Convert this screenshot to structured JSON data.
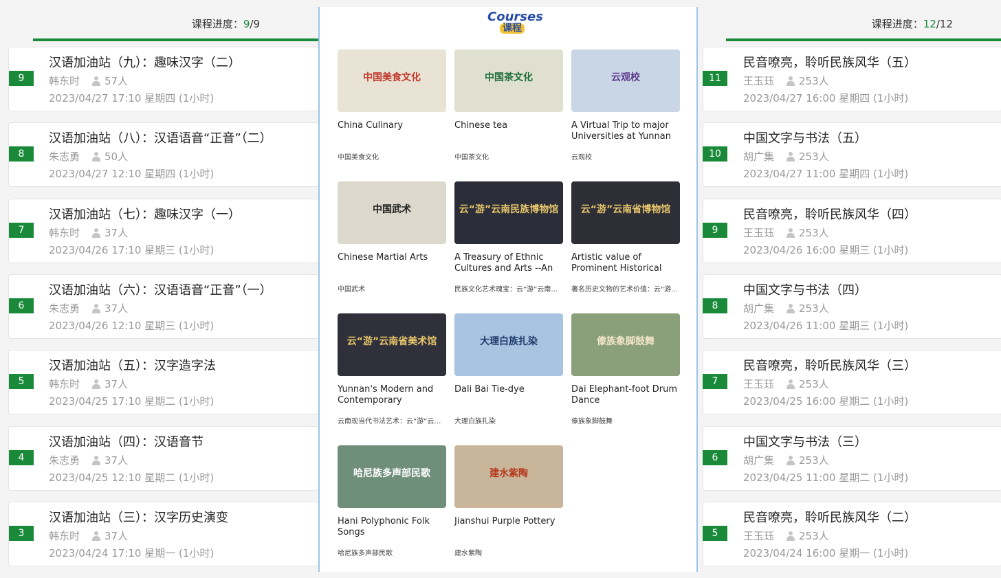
{
  "left_panel": {
    "progress_label": "课程进度：",
    "progress_done": "9",
    "progress_total": "/9",
    "items": [
      {
        "num": "9",
        "title": "汉语加油站（九）：趣味汉字（二）",
        "teacher": "韩东时",
        "count": "57人",
        "time": "2023/04/27 17:10 星期四 (1小时)"
      },
      {
        "num": "8",
        "title": "汉语加油站（八）：汉语语音“正音”（二）",
        "teacher": "朱志勇",
        "count": "50人",
        "time": "2023/04/27 12:10 星期四 (1小时)"
      },
      {
        "num": "7",
        "title": "汉语加油站（七）：趣味汉字（一）",
        "teacher": "韩东时",
        "count": "37人",
        "time": "2023/04/26 17:10 星期三 (1小时)"
      },
      {
        "num": "6",
        "title": "汉语加油站（六）：汉语语音“正音”（一）",
        "teacher": "朱志勇",
        "count": "37人",
        "time": "2023/04/26 12:10 星期三 (1小时)"
      },
      {
        "num": "5",
        "title": "汉语加油站（五）：汉字造字法",
        "teacher": "韩东时",
        "count": "37人",
        "time": "2023/04/25 17:10 星期二 (1小时)"
      },
      {
        "num": "4",
        "title": "汉语加油站（四）：汉语音节",
        "teacher": "朱志勇",
        "count": "37人",
        "time": "2023/04/25 12:10 星期二 (1小时)"
      },
      {
        "num": "3",
        "title": "汉语加油站（三）：汉字历史演变",
        "teacher": "韩东时",
        "count": "37人",
        "time": "2023/04/24 17:10 星期一 (1小时)"
      }
    ]
  },
  "right_panel": {
    "progress_label": "课程进度：",
    "progress_done": "12",
    "progress_total": "/12",
    "items": [
      {
        "num": "11",
        "title": "民音嘹亮，聆听民族风华（五）",
        "teacher": "王玉珏",
        "count": "253人",
        "time": "2023/04/27 16:00 星期四 (1小时)"
      },
      {
        "num": "10",
        "title": "中国文字与书法（五）",
        "teacher": "胡广集",
        "count": "253人",
        "time": "2023/04/27 11:00 星期四 (1小时)"
      },
      {
        "num": "9",
        "title": "民音嘹亮，聆听民族风华（四）",
        "teacher": "王玉珏",
        "count": "253人",
        "time": "2023/04/26 16:00 星期三 (1小时)"
      },
      {
        "num": "8",
        "title": "中国文字与书法（四）",
        "teacher": "胡广集",
        "count": "253人",
        "time": "2023/04/26 11:00 星期三 (1小时)"
      },
      {
        "num": "7",
        "title": "民音嘹亮，聆听民族风华（三）",
        "teacher": "王玉珏",
        "count": "253人",
        "time": "2023/04/25 16:00 星期二 (1小时)"
      },
      {
        "num": "6",
        "title": "中国文字与书法（三）",
        "teacher": "胡广集",
        "count": "253人",
        "time": "2023/04/25 11:00 星期二 (1小时)"
      },
      {
        "num": "5",
        "title": "民音嘹亮，聆听民族风华（二）",
        "teacher": "王玉珏",
        "count": "253人",
        "time": "2023/04/24 16:00 星期一 (1小时)"
      }
    ]
  },
  "center_panel": {
    "logo_en": "Courses",
    "logo_zh": "课程",
    "courses": [
      {
        "name": "China Culinary",
        "zh": "中国美食文化",
        "thumb_text": "中国美食文化",
        "bg": "#e9e3d6",
        "fg": "#c0392b"
      },
      {
        "name": "Chinese tea",
        "zh": "中国茶文化",
        "thumb_text": "中国茶文化",
        "bg": "#dfe0d0",
        "fg": "#1d6b3a"
      },
      {
        "name": "A Virtual Trip to major Universities at Yunnan Province",
        "zh": "云观校",
        "thumb_text": "云观校",
        "bg": "#c9d6e6",
        "fg": "#5b3a8c"
      },
      {
        "name": "Chinese Martial Arts",
        "zh": "中国武术",
        "thumb_text": "中国武术",
        "bg": "#dcd8cc",
        "fg": "#222222"
      },
      {
        "name": "A Treasury of Ethnic Cultures and Arts --An Online Tour at Yunnan Nationalities Museum",
        "zh": "民族文化艺术瑰宝：云“游”云南民族博物馆",
        "thumb_text": "云“游”云南民族博物馆",
        "bg": "#2b2d38",
        "fg": "#e7c66b"
      },
      {
        "name": "Artistic value of Prominent Historical Relics --An Online Tour at Yunnan Provincial Museum",
        "zh": "著名历史文物的艺术价值：云“游”云南省博物馆",
        "thumb_text": "云“游”云南省博物馆",
        "bg": "#2e2e36",
        "fg": "#e7c66b"
      },
      {
        "name": "Yunnan's Modern and Contemporary Calligraphic Art --An Online Tour at Yunnan Provincial Art Museum",
        "zh": "云南现当代书法艺术：云“游”云南省美术馆",
        "thumb_text": "云“游”云南省美术馆",
        "bg": "#30303a",
        "fg": "#e7c66b"
      },
      {
        "name": "Dali Bai Tie-dye",
        "zh": "大理白族扎染",
        "thumb_text": "大理白族扎染",
        "bg": "#a9c4e0",
        "fg": "#1f3b6b"
      },
      {
        "name": "Dai Elephant-foot Drum Dance",
        "zh": "傣族象脚鼓舞",
        "thumb_text": "傣族象脚鼓舞",
        "bg": "#8aa07a",
        "fg": "#f2e6c8"
      },
      {
        "name": "Hani Polyphonic Folk Songs",
        "zh": "哈尼族多声部民歌",
        "thumb_text": "哈尼族多声部民歌",
        "bg": "#6f8f7a",
        "fg": "#ffffff"
      },
      {
        "name": "Jianshui Purple Pottery",
        "zh": "建水紫陶",
        "thumb_text": "建水紫陶",
        "bg": "#c9b59a",
        "fg": "#b53a1f"
      }
    ]
  },
  "colors": {
    "accent": "#1a8a3a",
    "divider": "#9cc6e6"
  }
}
